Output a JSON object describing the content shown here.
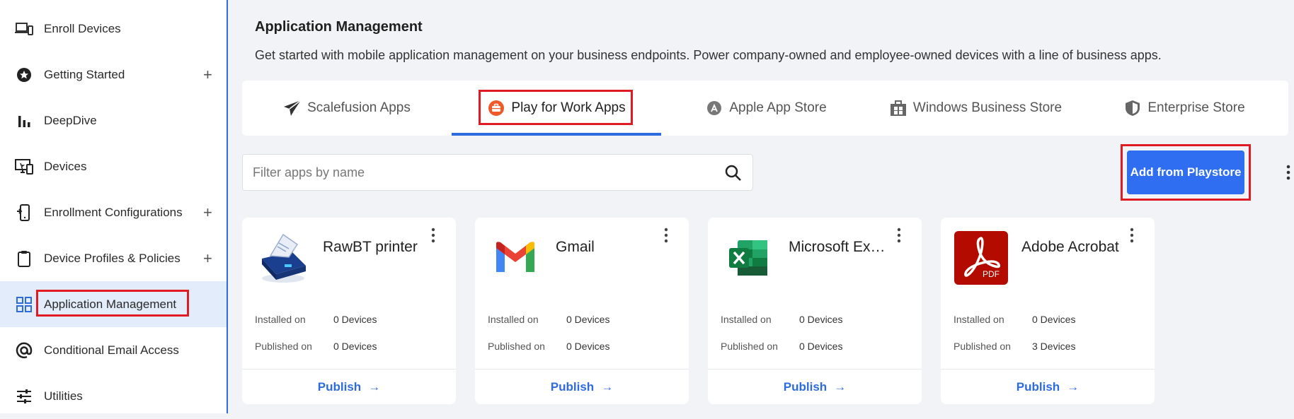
{
  "sidebar": {
    "items": [
      {
        "label": "Enroll Devices",
        "icon": "devices-icon",
        "plus": ""
      },
      {
        "label": "Getting Started",
        "icon": "star-badge-icon",
        "plus": "+"
      },
      {
        "label": "DeepDive",
        "icon": "bar-chart-icon",
        "plus": ""
      },
      {
        "label": "Devices",
        "icon": "monitor-icon",
        "plus": ""
      },
      {
        "label": "Enrollment Configurations",
        "icon": "phone-config-icon",
        "plus": "+"
      },
      {
        "label": "Device Profiles & Policies",
        "icon": "clipboard-icon",
        "plus": "+"
      },
      {
        "label": "Application Management",
        "icon": "grid-icon",
        "plus": ""
      },
      {
        "label": "Conditional Email Access",
        "icon": "at-icon",
        "plus": ""
      },
      {
        "label": "Utilities",
        "icon": "sliders-icon",
        "plus": ""
      }
    ]
  },
  "main": {
    "title": "Application Management",
    "description": "Get started with mobile application management on your business endpoints. Power company-owned and employee-owned devices with a line of business apps.",
    "tabs": [
      {
        "label": "Scalefusion Apps"
      },
      {
        "label": "Play for Work Apps"
      },
      {
        "label": "Apple App Store"
      },
      {
        "label": "Windows Business Store"
      },
      {
        "label": "Enterprise Store"
      }
    ],
    "search_placeholder": "Filter apps by name",
    "add_button": "Add from Playstore",
    "installed_label": "Installed on",
    "published_label": "Published on",
    "publish_label": "Publish",
    "publish_arrow": "→",
    "apps": [
      {
        "name": "RawBT printer",
        "installed": "0 Devices",
        "published": "0 Devices"
      },
      {
        "name": "Gmail",
        "installed": "0 Devices",
        "published": "0 Devices"
      },
      {
        "name": "Microsoft Excel",
        "installed": "0 Devices",
        "published": "0 Devices"
      },
      {
        "name": "Adobe Acrobat",
        "installed": "0 Devices",
        "published": "3 Devices"
      }
    ],
    "pdf_logo_text": "PDF"
  },
  "colors": {
    "accent": "#2e6bde",
    "button": "#2f6ef0",
    "highlight": "#e01b24"
  }
}
